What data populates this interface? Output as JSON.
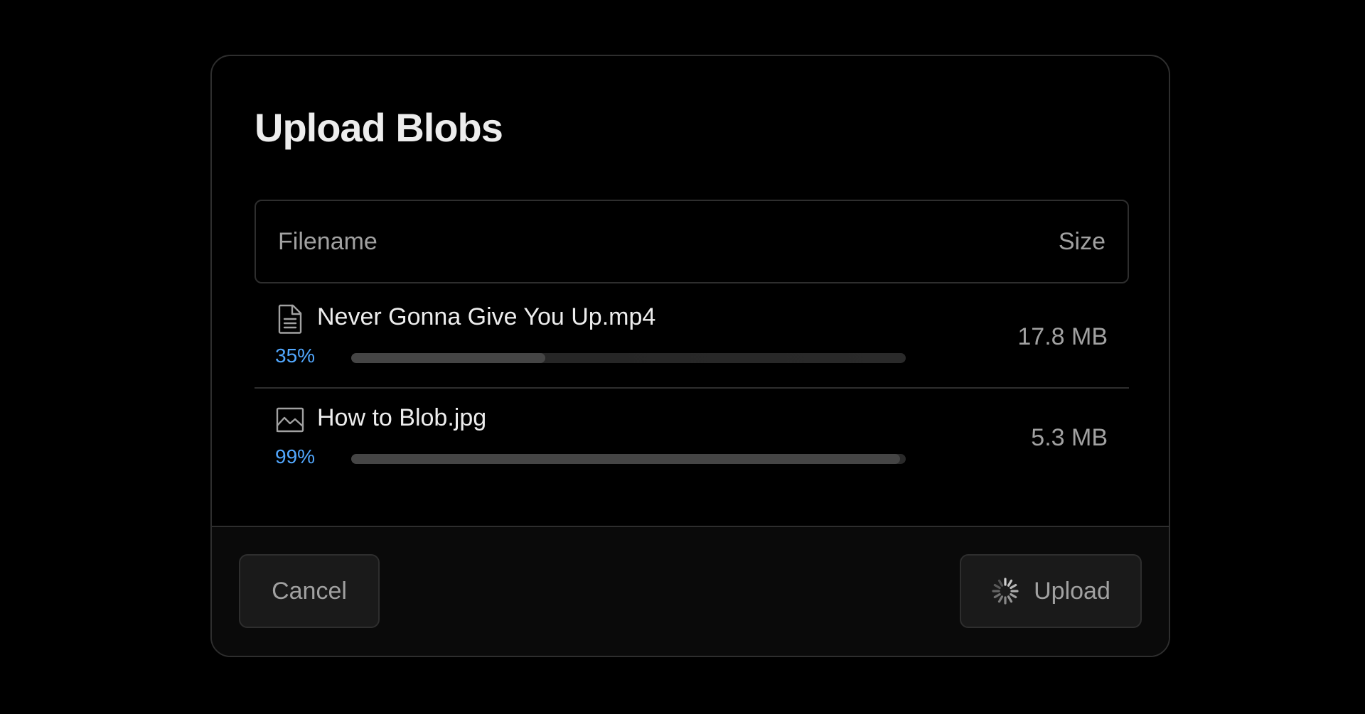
{
  "dialog": {
    "title": "Upload Blobs"
  },
  "table": {
    "headers": {
      "filename": "Filename",
      "size": "Size"
    },
    "rows": [
      {
        "icon": "document-icon",
        "filename": "Never Gonna Give You Up.mp4",
        "progress_label": "35%",
        "progress": 0.35,
        "size": "17.8 MB"
      },
      {
        "icon": "image-icon",
        "filename": "How to Blob.jpg",
        "progress_label": "99%",
        "progress": 0.99,
        "size": "5.3 MB"
      }
    ]
  },
  "footer": {
    "cancel_label": "Cancel",
    "upload_label": "Upload",
    "upload_icon": "spinner-icon"
  },
  "colors": {
    "background": "#000000",
    "border": "#2e2e2e",
    "progress_text": "#52a8ff",
    "progress_fill": "#454545",
    "muted_text": "#a1a1a1",
    "primary_text": "#ededed"
  }
}
